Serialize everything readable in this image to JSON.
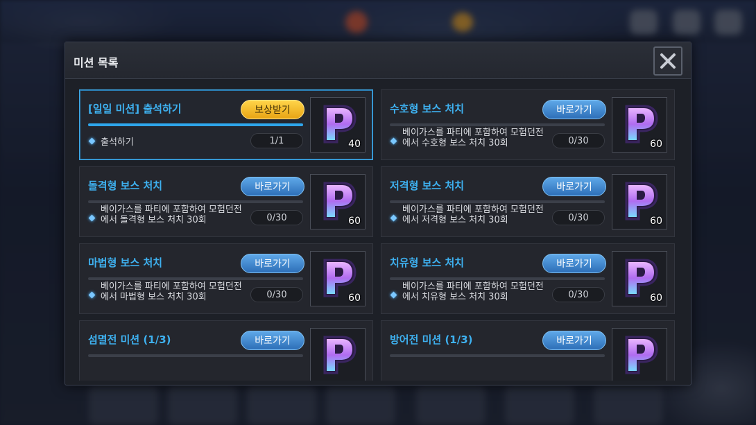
{
  "modal": {
    "title": "미션 목록"
  },
  "missions": [
    {
      "title": "[일일 미션] 출석하기",
      "button": "보상받기",
      "button_type": "claim",
      "progress": 1.0,
      "desc": "출석하기",
      "count": "1/1",
      "reward_icon": "p-point-icon",
      "reward_qty": "40"
    },
    {
      "title": "수호형 보스 처치",
      "button": "바로가기",
      "button_type": "go",
      "progress": 0,
      "desc": "베이가스를 파티에 포함하여 모험던전에서 수호형 보스 처치 30회",
      "count": "0/30",
      "reward_icon": "p-point-icon",
      "reward_qty": "60"
    },
    {
      "title": "돌격형 보스 처치",
      "button": "바로가기",
      "button_type": "go",
      "progress": 0,
      "desc": "베이가스를 파티에 포함하여 모험던전에서 돌격형 보스 처치 30회",
      "count": "0/30",
      "reward_icon": "p-point-icon",
      "reward_qty": "60"
    },
    {
      "title": "저격형 보스 처치",
      "button": "바로가기",
      "button_type": "go",
      "progress": 0,
      "desc": "베이가스를 파티에 포함하여 모험던전에서 저격형 보스 처치 30회",
      "count": "0/30",
      "reward_icon": "p-point-icon",
      "reward_qty": "60"
    },
    {
      "title": "마법형 보스 처치",
      "button": "바로가기",
      "button_type": "go",
      "progress": 0,
      "desc": "베이가스를 파티에 포함하여 모험던전에서 마법형 보스 처치 30회",
      "count": "0/30",
      "reward_icon": "p-point-icon",
      "reward_qty": "60"
    },
    {
      "title": "치유형 보스 처치",
      "button": "바로가기",
      "button_type": "go",
      "progress": 0,
      "desc": "베이가스를 파티에 포함하여 모험던전에서 치유형 보스 처치 30회",
      "count": "0/30",
      "reward_icon": "p-point-icon",
      "reward_qty": "60"
    },
    {
      "title": "섬멸전 미션 (1/3)",
      "button": "바로가기",
      "button_type": "go",
      "progress": 0,
      "desc": "",
      "count": "",
      "reward_icon": "p-point-icon",
      "reward_qty": ""
    },
    {
      "title": "방어전 미션 (1/3)",
      "button": "바로가기",
      "button_type": "go",
      "progress": 0,
      "desc": "",
      "count": "",
      "reward_icon": "p-point-icon",
      "reward_qty": ""
    }
  ],
  "colors": {
    "accent": "#3eb1f0",
    "claim_button": "#f5c22c",
    "go_button": "#3d86d0"
  }
}
